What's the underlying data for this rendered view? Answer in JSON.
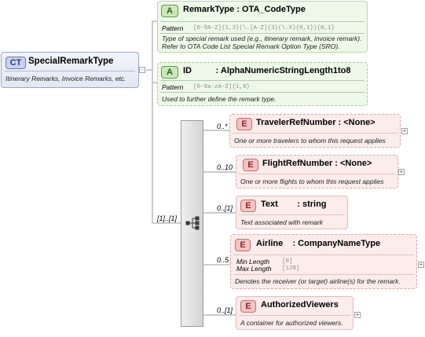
{
  "complex_type": {
    "badge": "CT",
    "name": "SpecialRemarkType",
    "doc": "Itinerary Remarks, Invoice Remarks, etc."
  },
  "attributes": [
    {
      "badge": "A",
      "title": "RemarkType : OTA_CodeType",
      "pattern_label": "Pattern",
      "pattern_value": "[0-9A-Z]{1,3}(\\.[A-Z]{3}(\\.X){0,1}){0,1}",
      "doc": "Type of special remark used (e.g., itinerary remark, invoice remark). Refer to OTA Code List Special Remark Option Type (SRO)."
    },
    {
      "badge": "A",
      "title": "ID          : AlphaNumericStringLength1to8",
      "pattern_label": "Pattern",
      "pattern_value": "[0-9a-zA-Z]{1,8}",
      "doc": "Used to further define the remark type."
    }
  ],
  "sequence_cardinality": "[1]..[1]",
  "elements": [
    {
      "badge": "E",
      "title": "TravelerRefNumber : <None>",
      "cardinality": "0..*",
      "doc": "One or more travelers to whom this request applies",
      "expand": "+"
    },
    {
      "badge": "E",
      "title": "FlightRefNumber : <None>",
      "cardinality": "0..10",
      "doc": "One or more flights to whom this request applies",
      "expand": "+"
    },
    {
      "badge": "E",
      "title": "Text        : string",
      "cardinality": "0..[1]",
      "doc": "Text associated with remark",
      "expand": ""
    },
    {
      "badge": "E",
      "title": "Airline    : CompanyNameType",
      "cardinality": "0..5",
      "facets": [
        {
          "label": "Min Length",
          "value": "[0]"
        },
        {
          "label": "Max Length",
          "value": "[128]"
        }
      ],
      "doc": "Denotes the receiver (or target) airline(s) for the remark.",
      "expand": "+"
    },
    {
      "badge": "E",
      "title": "AuthorizedViewers",
      "cardinality": "0..[1]",
      "doc": "A container for authorized viewers.",
      "expand": "+"
    }
  ],
  "ct_expand": "-"
}
